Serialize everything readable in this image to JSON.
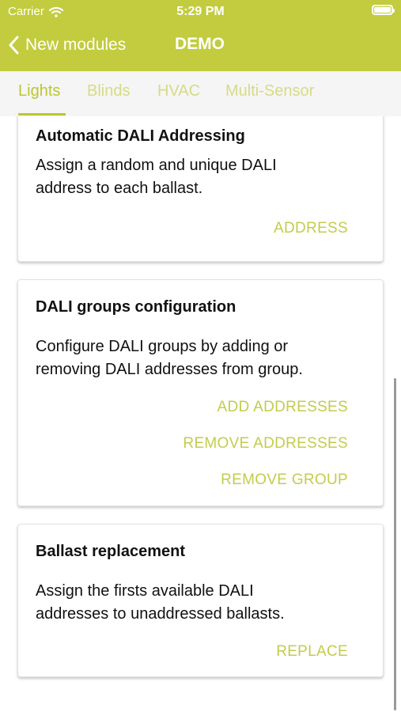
{
  "status_bar": {
    "carrier": "Carrier",
    "time": "5:29 PM"
  },
  "nav": {
    "back_label": "New modules",
    "title": "DEMO"
  },
  "tabs": [
    {
      "label": "Lights",
      "active": true
    },
    {
      "label": "Blinds",
      "active": false
    },
    {
      "label": "HVAC",
      "active": false
    },
    {
      "label": "Multi-Sensor",
      "active": false
    }
  ],
  "cards": [
    {
      "title": "Automatic DALI Addressing",
      "description_lines": [
        "Assign a random and unique DALI",
        "address to each ballast."
      ],
      "actions": [
        "ADDRESS"
      ]
    },
    {
      "title": "DALI groups configuration",
      "description_lines": [
        "Configure DALI groups by adding or",
        "removing DALI addresses from group."
      ],
      "actions": [
        "ADD ADDRESSES",
        "REMOVE ADDRESSES",
        "REMOVE GROUP"
      ]
    },
    {
      "title": "Ballast replacement",
      "description_lines": [
        "Assign the firsts available DALI",
        "addresses to unaddressed ballasts."
      ],
      "actions": [
        "REPLACE"
      ]
    }
  ],
  "colors": {
    "brand": "#c2cc3e",
    "accent_text": "#c3cc4c",
    "inactive_tab": "#d6db86",
    "tab_bar_bg": "#f5f5f5"
  }
}
